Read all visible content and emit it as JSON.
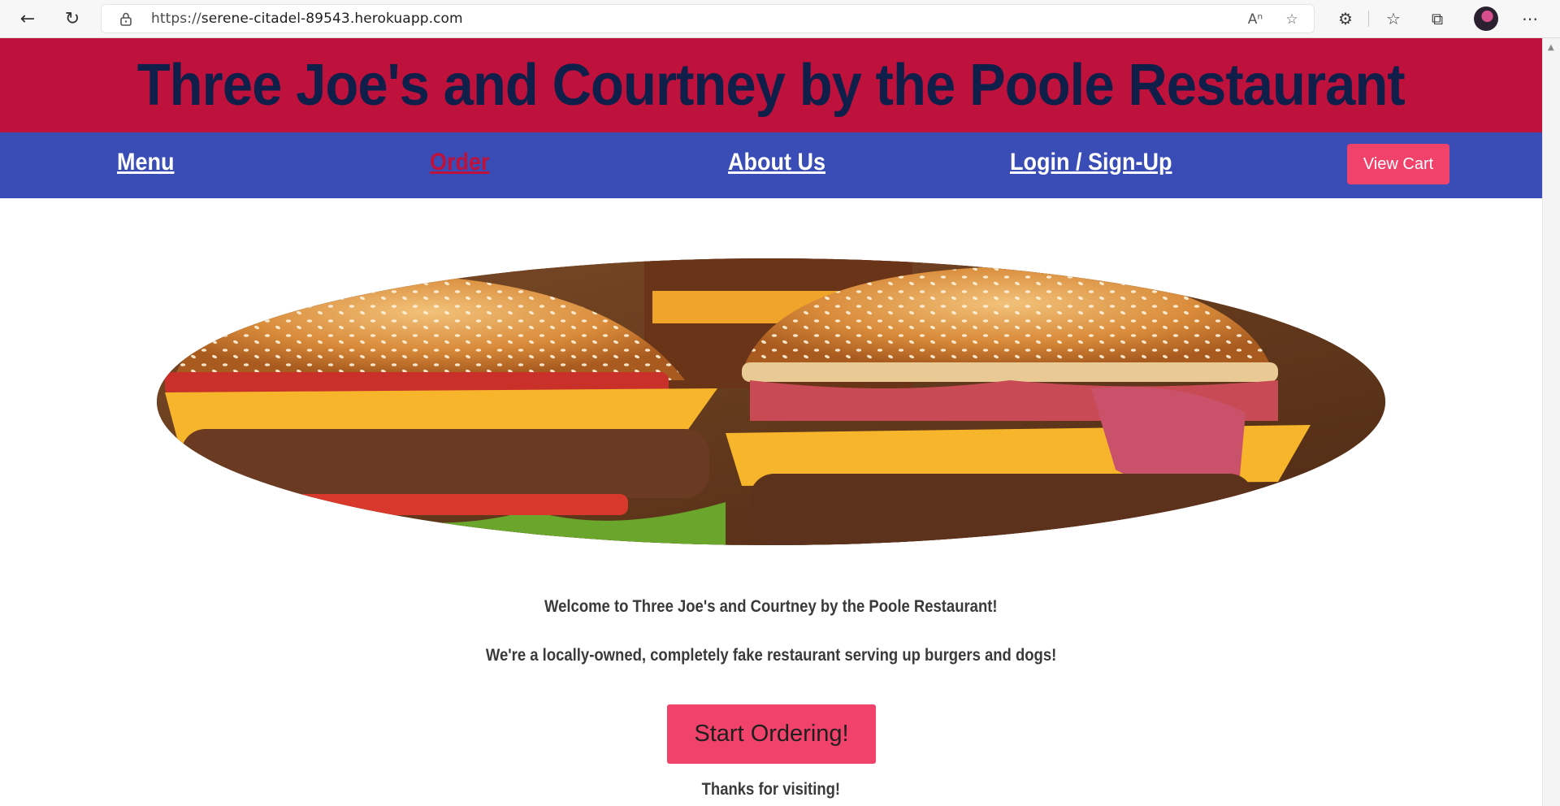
{
  "browser": {
    "url_scheme": "https://",
    "url_host": "serene-citadel-89543.herokuapp.com",
    "icons": [
      "back-icon",
      "refresh-icon",
      "lock-icon",
      "read-aloud-icon",
      "favorite-add-icon",
      "extensions-icon",
      "favorites-icon",
      "collections-icon",
      "avatar",
      "more-icon"
    ]
  },
  "site": {
    "title": "Three Joe's and Courtney by the Poole Restaurant",
    "colors": {
      "banner": "#be123c",
      "title": "#0f1f4a",
      "nav": "#3a4cb6",
      "accent": "#f0426a"
    }
  },
  "nav": {
    "items": [
      {
        "label": "Menu",
        "active": false
      },
      {
        "label": "Order",
        "active": true
      },
      {
        "label": "About Us",
        "active": false
      },
      {
        "label": "Login / Sign-Up",
        "active": false
      }
    ],
    "cart_label": "View Cart"
  },
  "main": {
    "welcome_line": "Welcome to Three Joe's and Courtney by the Poole Restaurant!",
    "tagline": "We're a locally-owned, completely fake restaurant serving up burgers and dogs!",
    "order_button": "Start Ordering!",
    "thanks": "Thanks for visiting!"
  }
}
